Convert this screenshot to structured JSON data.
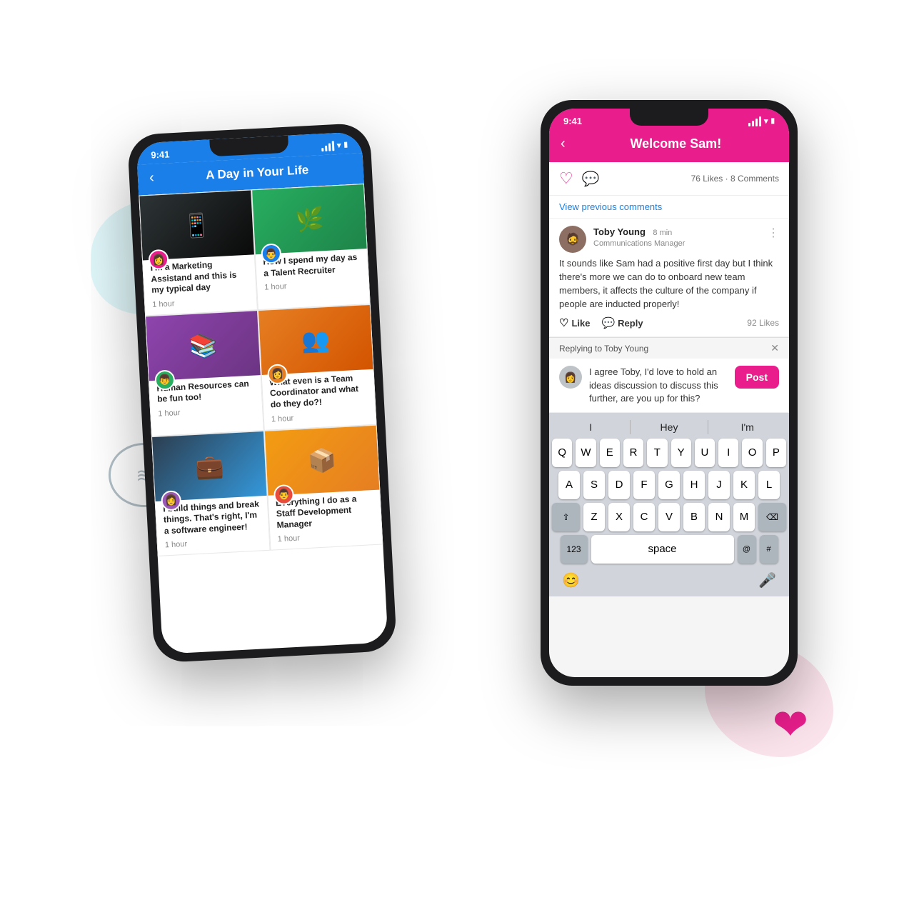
{
  "scene": {
    "phone_left": {
      "status_bar": {
        "time": "9:41",
        "signal": "signal",
        "wifi": "wifi",
        "battery": "battery"
      },
      "header": {
        "title": "A Day in Your Life",
        "back": "‹"
      },
      "cards": [
        {
          "id": "card-1",
          "img_type": "dark",
          "img_emoji": "📱",
          "avatar_emoji": "👩",
          "avatar_bg": "#e91e8c",
          "title": "I'm a Marketing Assistand and this is my typical day",
          "time": "1 hour"
        },
        {
          "id": "card-2",
          "img_type": "green",
          "img_emoji": "🌿",
          "avatar_emoji": "👨",
          "avatar_bg": "#1a7fe8",
          "title": "How I spend my day as a Talent Recruiter",
          "time": "1 hour"
        },
        {
          "id": "card-3",
          "img_type": "books",
          "img_emoji": "📚",
          "avatar_emoji": "👦",
          "avatar_bg": "#27ae60",
          "title": "Human Resources can be fun too!",
          "time": "1 hour"
        },
        {
          "id": "card-4",
          "img_type": "people",
          "img_emoji": "👥",
          "avatar_emoji": "👩",
          "avatar_bg": "#e67e22",
          "title": "What even is a Team Coordinator and what do they do?!",
          "time": "1 hour"
        },
        {
          "id": "card-5",
          "img_type": "meeting",
          "img_emoji": "💼",
          "avatar_emoji": "👩",
          "avatar_bg": "#9b59b6",
          "title": "I build things and break things. That's right, I'm a software engineer!",
          "time": "1 hour"
        },
        {
          "id": "card-6",
          "img_type": "warehouse",
          "img_emoji": "📦",
          "avatar_emoji": "👨",
          "avatar_bg": "#e74c3c",
          "title": "Everything I do as a Staff Development Manager",
          "time": "1 hour"
        }
      ]
    },
    "phone_right": {
      "status_bar": {
        "time": "9:41",
        "signal": "signal",
        "wifi": "wifi",
        "battery": "battery"
      },
      "header": {
        "title": "Welcome Sam!",
        "back": "‹"
      },
      "social_bar": {
        "heart_icon": "♡",
        "chat_icon": "💬",
        "likes": "76 Likes",
        "dot": "·",
        "comments": "8 Comments"
      },
      "view_previous": "View previous comments",
      "comment": {
        "avatar_emoji": "🧔",
        "avatar_bg": "#8d6e63",
        "name": "Toby Young",
        "time": "8 min",
        "role": "Communications Manager",
        "text": "It sounds like Sam had a positive first day but I think there's more we can do to onboard new team members, it affects the culture of the company if people are inducted properly!",
        "like_label": "Like",
        "reply_label": "Reply",
        "likes_count": "92 Likes"
      },
      "reply_bar": {
        "replying_to": "Replying to Toby Young",
        "close": "✕"
      },
      "reply_input": {
        "avatar_emoji": "👩",
        "avatar_bg": "#bdc3c7",
        "text": "I agree Toby, I'd love to hold an ideas discussion to discuss this further, are you up for this?",
        "post_btn": "Post"
      },
      "keyboard": {
        "predictive": [
          "I",
          "Hey",
          "I'm"
        ],
        "row1": [
          "Q",
          "W",
          "E",
          "R",
          "T",
          "Y",
          "U",
          "I",
          "O",
          "P"
        ],
        "row2": [
          "A",
          "S",
          "D",
          "F",
          "G",
          "H",
          "J",
          "K",
          "L"
        ],
        "row3": [
          "Z",
          "X",
          "C",
          "V",
          "B",
          "N",
          "M"
        ],
        "bottom": {
          "num": "123",
          "space": "space",
          "at": "@",
          "hash": "#"
        },
        "emoji_icon": "😊",
        "mic_icon": "🎤"
      }
    }
  },
  "decorations": {
    "heart": "❤",
    "chat_lines": "≋"
  }
}
